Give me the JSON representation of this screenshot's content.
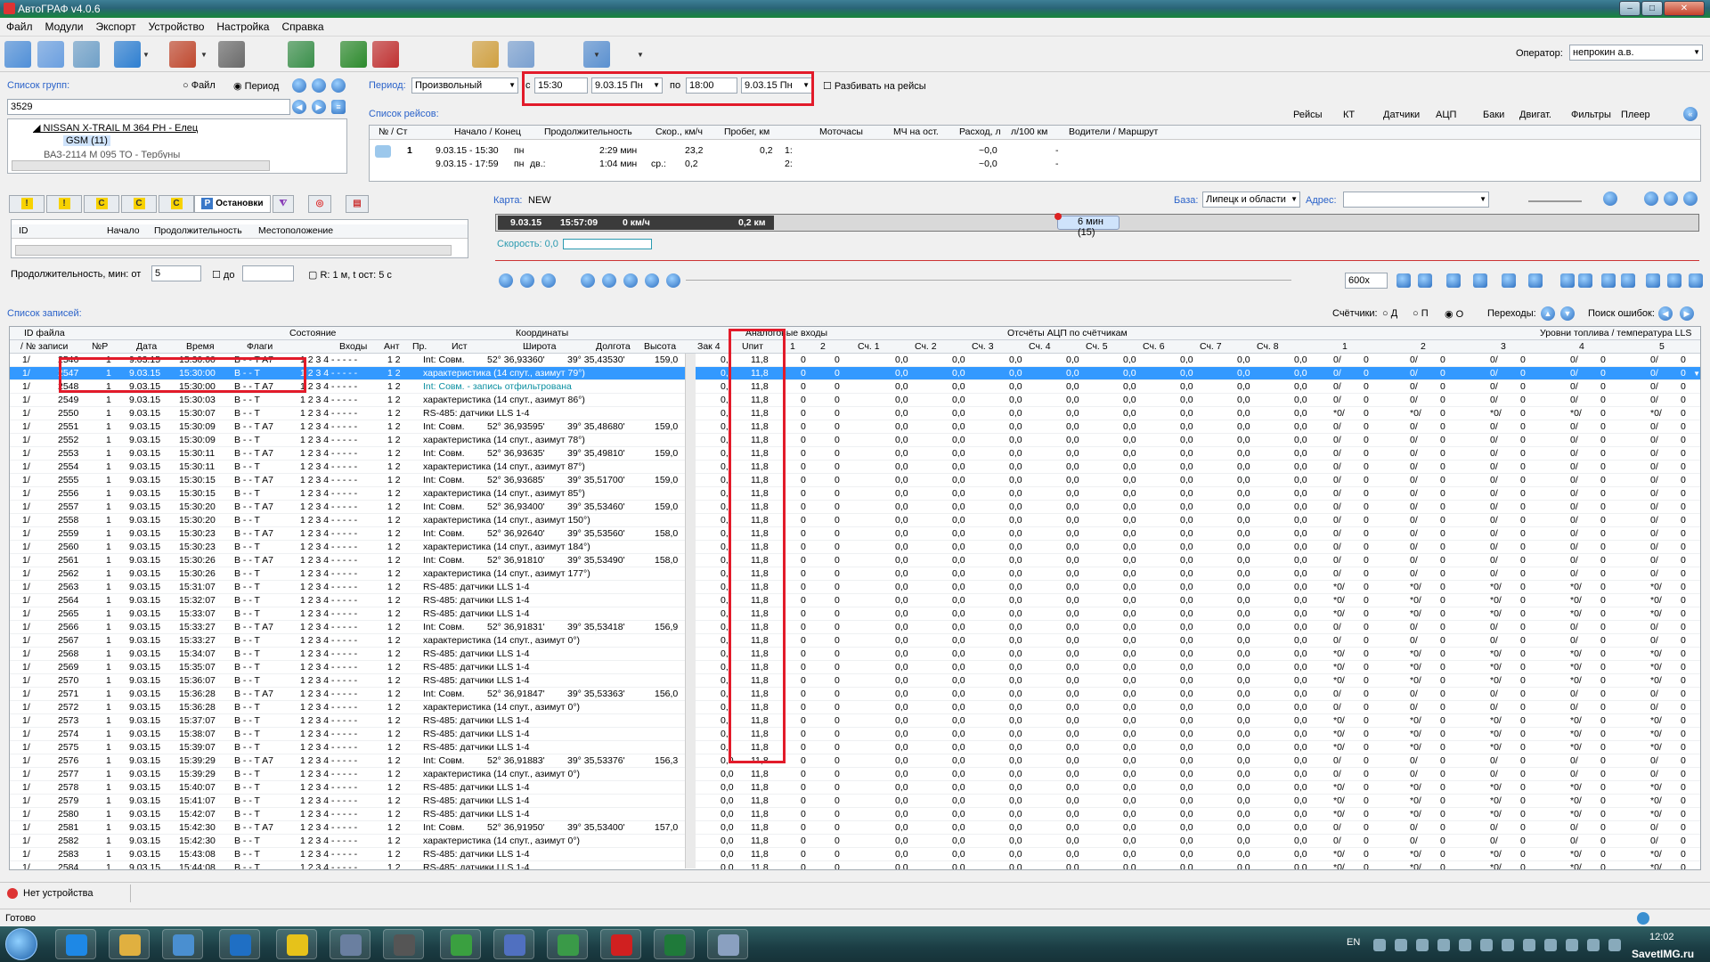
{
  "window": {
    "title": "АвтоГРАФ v4.0.6"
  },
  "menu": [
    "Файл",
    "Модули",
    "Экспорт",
    "Устройство",
    "Настройка",
    "Справка"
  ],
  "operator": {
    "label": "Оператор:",
    "value": "непрокин а.в."
  },
  "groups": {
    "label": "Список групп:",
    "mode_file": "Файл",
    "mode_period": "Период",
    "search": "3529",
    "tree": [
      "NISSAN X-TRAIL М 364 РН - Елец",
      "GSM (11)",
      "ВАЗ-2114 М 095 ТО - Тербуны"
    ]
  },
  "period": {
    "label": "Период:",
    "type": "Произвольный",
    "from_label": "с",
    "from_time": "15:30",
    "from_date": "9.03.15 Пн",
    "to_label": "по",
    "to_time": "18:00",
    "to_date": "9.03.15 Пн",
    "split": "Разбивать на рейсы"
  },
  "trips": {
    "label": "Список рейсов:",
    "links": [
      "Рейсы",
      "КТ",
      "Датчики",
      "АЦП",
      "Баки",
      "Двигат.",
      "Фильтры",
      "Плеер"
    ],
    "headers": [
      "№ / Ст",
      "Начало / Конец",
      "Продолжительность",
      "Скор., км/ч",
      "Пробег, км",
      "Моточасы",
      "МЧ на ост.",
      "Расход, л",
      "л/100 км",
      "Водители / Маршрут"
    ],
    "row1": {
      "num": "1",
      "start": "9.03.15 - 15:30",
      "start_d": "пн",
      "dur": "2:29 мин",
      "speed": "23,2",
      "mil": "0,2",
      "moto_l": "1:",
      "fuel": "~0,0",
      "per100": "-"
    },
    "row2": {
      "end": "9.03.15 - 17:59",
      "end_d": "пн",
      "dur_l": "дв.:",
      "dur": "1:04 мин",
      "speed_l": "ср.:",
      "speed": "0,2",
      "moto_l": "2:",
      "fuel": "~0,0",
      "per100": "-"
    }
  },
  "stops": {
    "tab_active": "Остановки",
    "headers": [
      "ID",
      "Начало",
      "Продолжительность",
      "Местоположение"
    ],
    "dur_label": "Продолжительность, мин: от",
    "dur_from": "5",
    "dur_to_label": "до",
    "info": "R: 1 м, t ост: 5 с",
    "tab_letters": [
      "!",
      "!",
      "C",
      "C",
      "C"
    ]
  },
  "map": {
    "label": "Карта:",
    "name": "NEW",
    "base_label": "База:",
    "base": "Липецк и области",
    "addr_label": "Адрес:",
    "date": "9.03.15",
    "time": "15:57:09",
    "speed": "0 км/ч",
    "dist": "0,2 км",
    "stop": "6 мин (15)",
    "speed_label": "Скорость: 0,0",
    "zoom": "600х"
  },
  "records": {
    "label": "Список записей:",
    "counters_label": "Счётчики:",
    "c_opts": [
      "Д",
      "П",
      "О"
    ],
    "transitions": "Переходы:",
    "errors": "Поиск ошибок:",
    "h1": [
      "ID файла",
      "Состояние",
      "Координаты",
      "Аналоговые входы",
      "Отсчёты АЦП по счётчикам",
      "Уровни топлива / температура LLS"
    ],
    "h2": [
      "/ № записи",
      "№Р",
      "Дата",
      "Время",
      "Флаги",
      "Входы",
      "Ант",
      "Пр.",
      "Ист",
      "Широта",
      "Долгота",
      "Высота",
      "Зак 4",
      "Uпит",
      "1",
      "2",
      "Сч. 1",
      "Сч. 2",
      "Сч. 3",
      "Сч. 4",
      "Сч. 5",
      "Сч. 6",
      "Сч. 7",
      "Сч. 8",
      "1",
      "2",
      "3",
      "4",
      "5"
    ],
    "rows": [
      [
        "2546",
        "15:30:00",
        "B - - T A7",
        "Int: Совм.",
        "52° 36,93360'",
        "39° 35,43530'",
        "159,0",
        "0,",
        "11,8",
        "0/"
      ],
      [
        "2547",
        "15:30:00",
        "B - - T",
        "характеристика (14 спут., азимут 79°)",
        "",
        "",
        "",
        "0,",
        "11,8",
        "0/"
      ],
      [
        "2548",
        "15:30:00",
        "B - - T A7",
        "Int: Совм. - запись отфильтрована",
        "",
        "",
        "",
        "0,",
        "11,8",
        "0/"
      ],
      [
        "2549",
        "15:30:03",
        "B - - T",
        "характеристика (14 спут., азимут 86°)",
        "",
        "",
        "",
        "0,",
        "11,8",
        "0/"
      ],
      [
        "2550",
        "15:30:07",
        "B - - T",
        "RS-485: датчики LLS 1-4",
        "",
        "",
        "",
        "0,",
        "11,8",
        "*0/"
      ],
      [
        "2551",
        "15:30:09",
        "B - - T A7",
        "Int: Совм.",
        "52° 36,93595'",
        "39° 35,48680'",
        "159,0",
        "0,",
        "11,8",
        "0/"
      ],
      [
        "2552",
        "15:30:09",
        "B - - T",
        "характеристика (14 спут., азимут 78°)",
        "",
        "",
        "",
        "0,",
        "11,8",
        "0/"
      ],
      [
        "2553",
        "15:30:11",
        "B - - T A7",
        "Int: Совм.",
        "52° 36,93635'",
        "39° 35,49810'",
        "159,0",
        "0,",
        "11,8",
        "0/"
      ],
      [
        "2554",
        "15:30:11",
        "B - - T",
        "характеристика (14 спут., азимут 87°)",
        "",
        "",
        "",
        "0,",
        "11,8",
        "0/"
      ],
      [
        "2555",
        "15:30:15",
        "B - - T A7",
        "Int: Совм.",
        "52° 36,93685'",
        "39° 35,51700'",
        "159,0",
        "0,",
        "11,8",
        "0/"
      ],
      [
        "2556",
        "15:30:15",
        "B - - T",
        "характеристика (14 спут., азимут 85°)",
        "",
        "",
        "",
        "0,",
        "11,8",
        "0/"
      ],
      [
        "2557",
        "15:30:20",
        "B - - T A7",
        "Int: Совм.",
        "52° 36,93400'",
        "39° 35,53460'",
        "159,0",
        "0,",
        "11,8",
        "0/"
      ],
      [
        "2558",
        "15:30:20",
        "B - - T",
        "характеристика (14 спут., азимут 150°)",
        "",
        "",
        "",
        "0,",
        "11,8",
        "0/"
      ],
      [
        "2559",
        "15:30:23",
        "B - - T A7",
        "Int: Совм.",
        "52° 36,92640'",
        "39° 35,53560'",
        "158,0",
        "0,",
        "11,8",
        "0/"
      ],
      [
        "2560",
        "15:30:23",
        "B - - T",
        "характеристика (14 спут., азимут 184°)",
        "",
        "",
        "",
        "0,",
        "11,8",
        "0/"
      ],
      [
        "2561",
        "15:30:26",
        "B - - T A7",
        "Int: Совм.",
        "52° 36,91810'",
        "39° 35,53490'",
        "158,0",
        "0,",
        "11,8",
        "0/"
      ],
      [
        "2562",
        "15:30:26",
        "B - - T",
        "характеристика (14 спут., азимут 177°)",
        "",
        "",
        "",
        "0,",
        "11,8",
        "0/"
      ],
      [
        "2563",
        "15:31:07",
        "B - - T",
        "RS-485: датчики LLS 1-4",
        "",
        "",
        "",
        "0,",
        "11,8",
        "*0/"
      ],
      [
        "2564",
        "15:32:07",
        "B - - T",
        "RS-485: датчики LLS 1-4",
        "",
        "",
        "",
        "0,",
        "11,8",
        "*0/"
      ],
      [
        "2565",
        "15:33:07",
        "B - - T",
        "RS-485: датчики LLS 1-4",
        "",
        "",
        "",
        "0,",
        "11,8",
        "*0/"
      ],
      [
        "2566",
        "15:33:27",
        "B - - T A7",
        "Int: Совм.",
        "52° 36,91831'",
        "39° 35,53418'",
        "156,9",
        "0,",
        "11,8",
        "0/"
      ],
      [
        "2567",
        "15:33:27",
        "B - - T",
        "характеристика (14 спут., азимут 0°)",
        "",
        "",
        "",
        "0,",
        "11,8",
        "0/"
      ],
      [
        "2568",
        "15:34:07",
        "B - - T",
        "RS-485: датчики LLS 1-4",
        "",
        "",
        "",
        "0,",
        "11,8",
        "*0/"
      ],
      [
        "2569",
        "15:35:07",
        "B - - T",
        "RS-485: датчики LLS 1-4",
        "",
        "",
        "",
        "0,",
        "11,8",
        "*0/"
      ],
      [
        "2570",
        "15:36:07",
        "B - - T",
        "RS-485: датчики LLS 1-4",
        "",
        "",
        "",
        "0,",
        "11,8",
        "*0/"
      ],
      [
        "2571",
        "15:36:28",
        "B - - T A7",
        "Int: Совм.",
        "52° 36,91847'",
        "39° 35,53363'",
        "156,0",
        "0,",
        "11,8",
        "0/"
      ],
      [
        "2572",
        "15:36:28",
        "B - - T",
        "характеристика (14 спут., азимут 0°)",
        "",
        "",
        "",
        "0,",
        "11,8",
        "0/"
      ],
      [
        "2573",
        "15:37:07",
        "B - - T",
        "RS-485: датчики LLS 1-4",
        "",
        "",
        "",
        "0,",
        "11,8",
        "*0/"
      ],
      [
        "2574",
        "15:38:07",
        "B - - T",
        "RS-485: датчики LLS 1-4",
        "",
        "",
        "",
        "0,",
        "11,8",
        "*0/"
      ],
      [
        "2575",
        "15:39:07",
        "B - - T",
        "RS-485: датчики LLS 1-4",
        "",
        "",
        "",
        "0,",
        "11,8",
        "*0/"
      ],
      [
        "2576",
        "15:39:29",
        "B - - T A7",
        "Int: Совм.",
        "52° 36,91883'",
        "39° 35,53376'",
        "156,3",
        "0,0",
        "11,8",
        "0/"
      ],
      [
        "2577",
        "15:39:29",
        "B - - T",
        "характеристика (14 спут., азимут 0°)",
        "",
        "",
        "",
        "0,0",
        "11,8",
        "0/"
      ],
      [
        "2578",
        "15:40:07",
        "B - - T",
        "RS-485: датчики LLS 1-4",
        "",
        "",
        "",
        "0,0",
        "11,8",
        "*0/"
      ],
      [
        "2579",
        "15:41:07",
        "B - - T",
        "RS-485: датчики LLS 1-4",
        "",
        "",
        "",
        "0,0",
        "11,8",
        "*0/"
      ],
      [
        "2580",
        "15:42:07",
        "B - - T",
        "RS-485: датчики LLS 1-4",
        "",
        "",
        "",
        "0,0",
        "11,8",
        "*0/"
      ],
      [
        "2581",
        "15:42:30",
        "B - - T A7",
        "Int: Совм.",
        "52° 36,91950'",
        "39° 35,53400'",
        "157,0",
        "0,0",
        "11,8",
        "0/"
      ],
      [
        "2582",
        "15:42:30",
        "B - - T",
        "характеристика (14 спут., азимут 0°)",
        "",
        "",
        "",
        "0,0",
        "11,8",
        "0/"
      ],
      [
        "2583",
        "15:43:08",
        "B - - T",
        "RS-485: датчики LLS 1-4",
        "",
        "",
        "",
        "0,0",
        "11,8",
        "*0/"
      ],
      [
        "2584",
        "15:44:08",
        "B - - T",
        "RS-485: датчики LLS 1-4",
        "",
        "",
        "",
        "0,0",
        "11,8",
        "*0/"
      ]
    ],
    "row_common": {
      "file": "1/",
      "np": "1",
      "date": "9.03.15",
      "inputs": "1 2 3 4 - - - - -",
      "ant": "1 2",
      "zero": "0",
      "cnt": "0,0"
    }
  },
  "status": {
    "device": "Нет устройства",
    "ready": "Готово"
  },
  "taskbar": {
    "lang": "EN",
    "time": "12:02",
    "watermark": "SavetIMG.ru"
  },
  "colors": {
    "red": "#e21b2a",
    "select": "#3399ff",
    "link": "#2a62c9"
  }
}
